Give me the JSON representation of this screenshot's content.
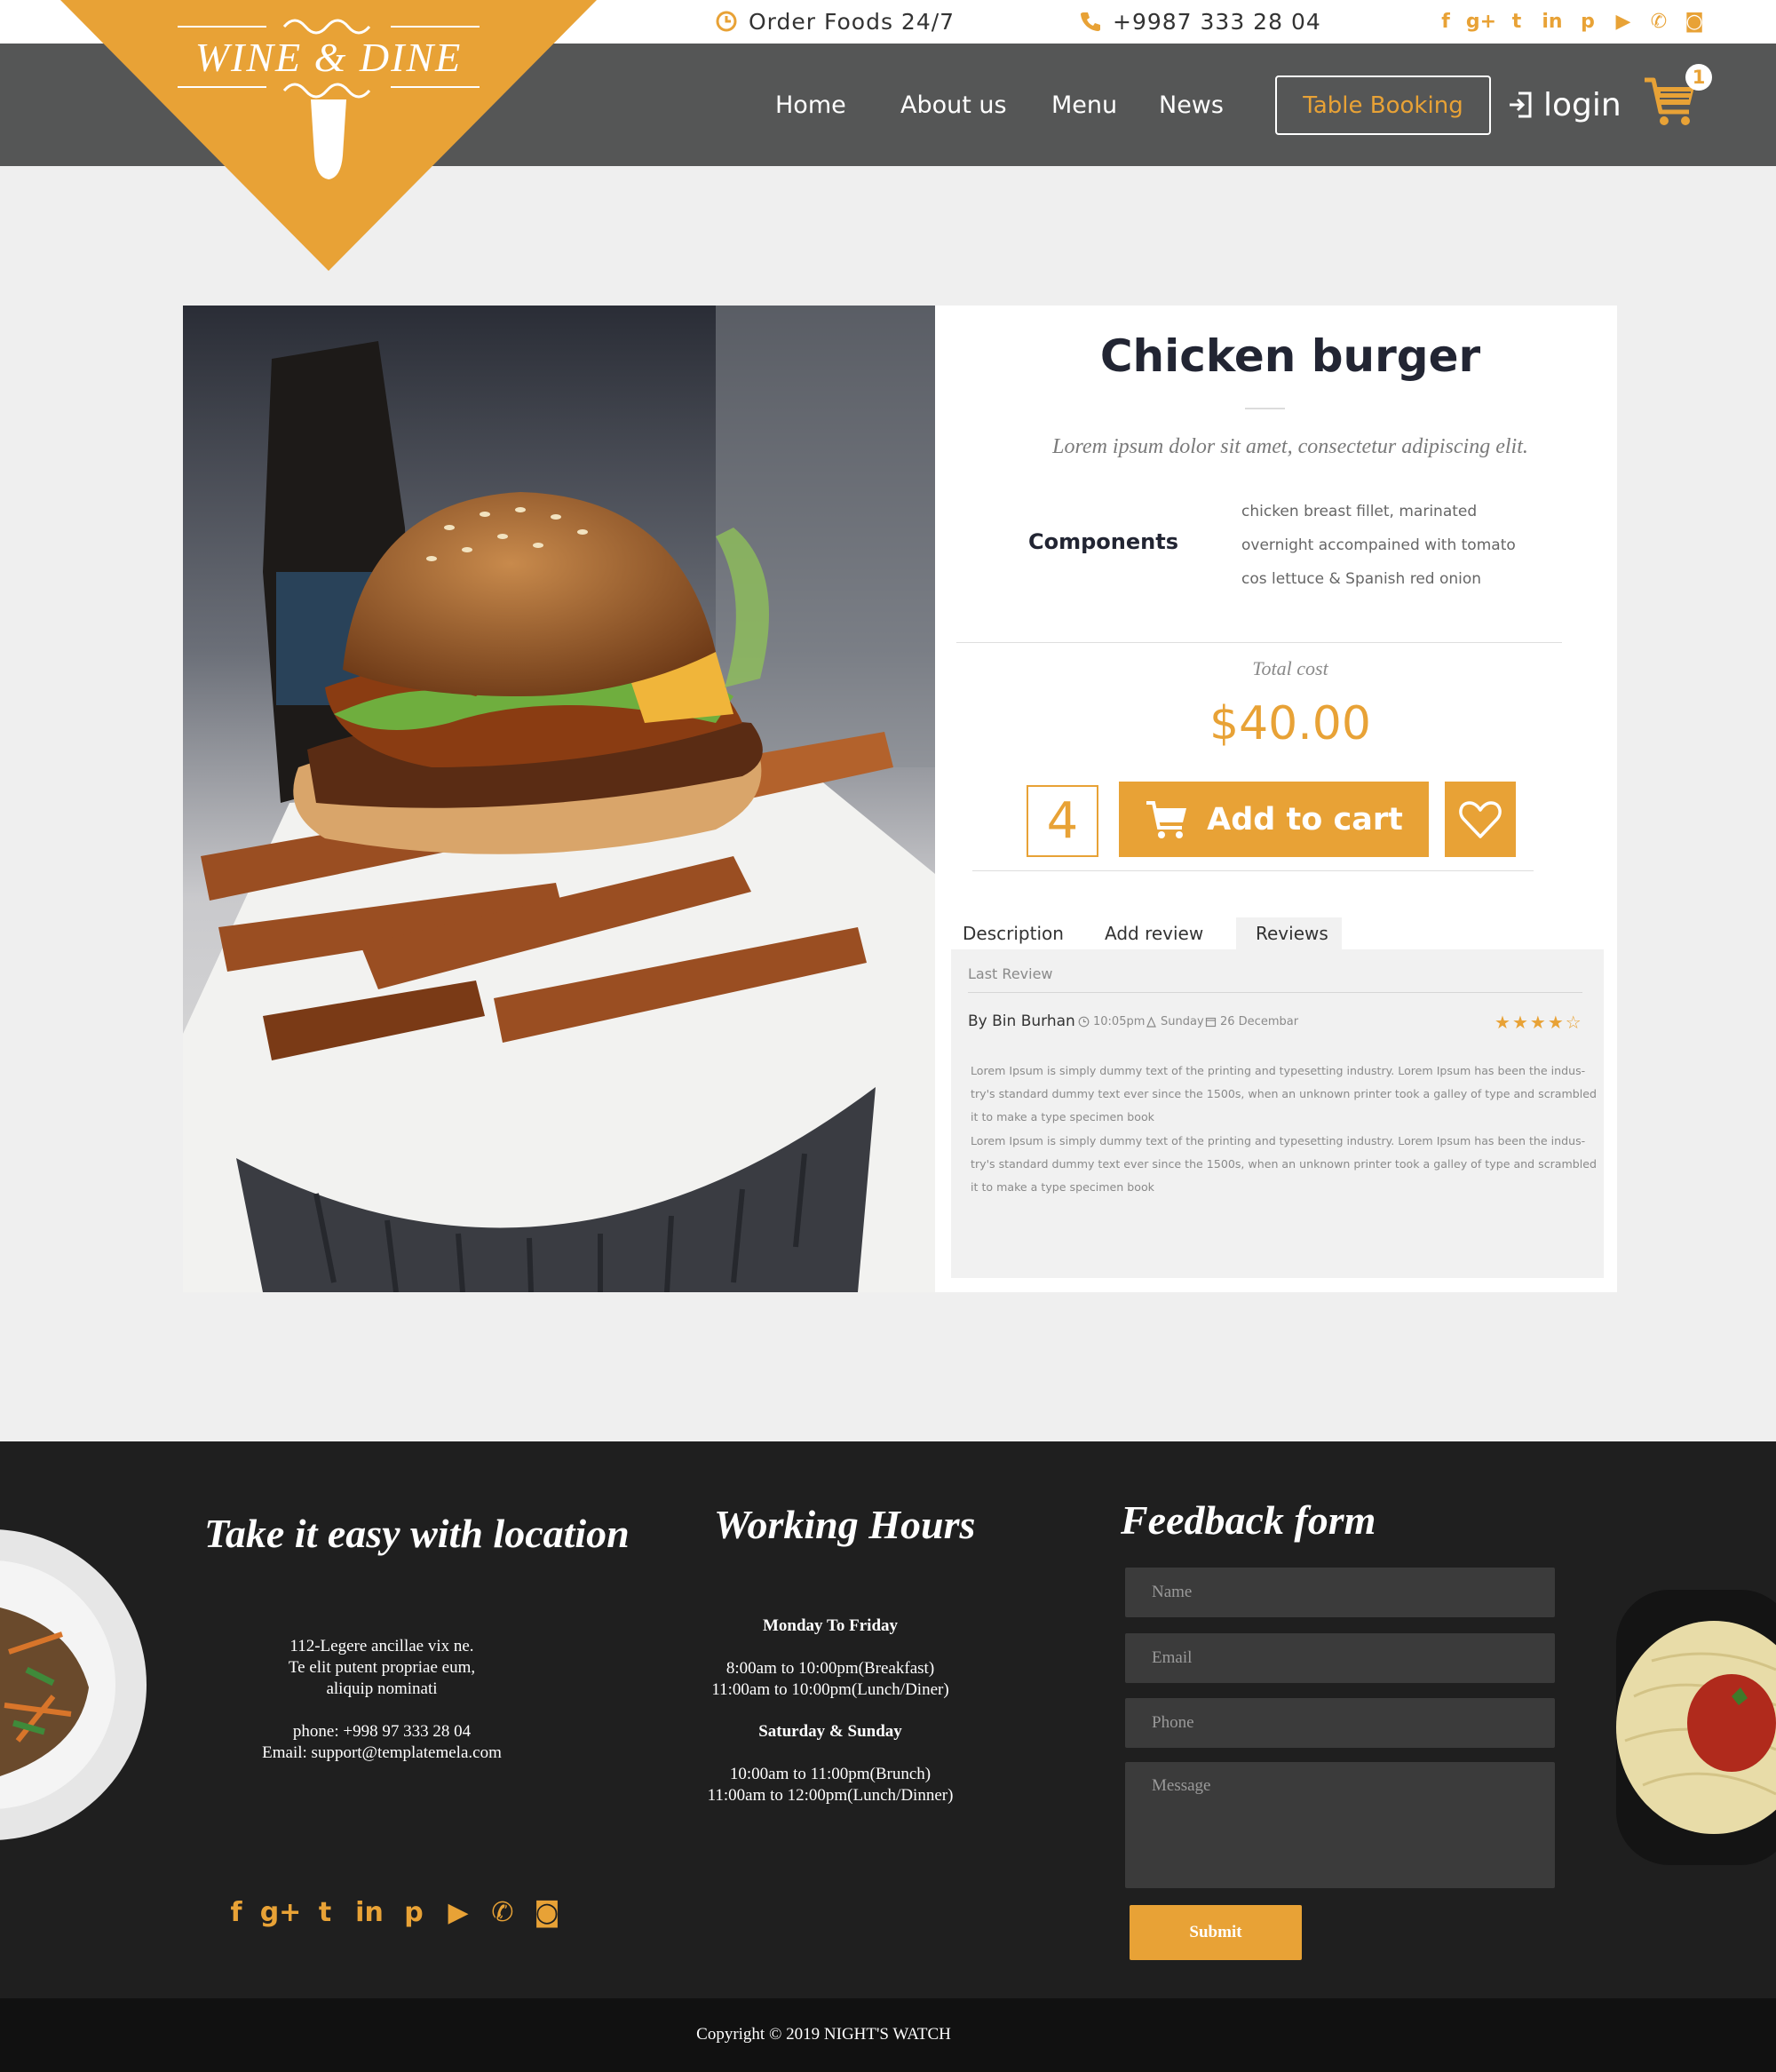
{
  "brand": {
    "name": "WINE & DINE",
    "accent_color": "#e8a236"
  },
  "topbar": {
    "order_text": "Order Foods 24/7",
    "order_icon": "clock-icon",
    "phone_text": "+9987 333 28 04",
    "phone_icon": "phone-icon",
    "social": [
      {
        "icon": "facebook-icon",
        "glyph": "f"
      },
      {
        "icon": "google-plus-icon",
        "glyph": "g+"
      },
      {
        "icon": "twitter-icon",
        "glyph": "t"
      },
      {
        "icon": "linkedin-icon",
        "glyph": "in"
      },
      {
        "icon": "pinterest-icon",
        "glyph": "p"
      },
      {
        "icon": "youtube-icon",
        "glyph": "▶"
      },
      {
        "icon": "whatsapp-icon",
        "glyph": "✆"
      },
      {
        "icon": "instagram-icon",
        "glyph": "◙"
      }
    ]
  },
  "nav": {
    "items": [
      "Home",
      "About us",
      "Menu",
      "News"
    ],
    "booking": "Table Booking",
    "login": "login",
    "cart_count": "1"
  },
  "product": {
    "title": "Chicken burger",
    "subtitle": "Lorem ipsum dolor sit amet, consectetur adipiscing elit.",
    "components_label": "Components",
    "components_lines": [
      "chicken breast fillet, marinated",
      "overnight accompained with tomato",
      "cos lettuce & Spanish red onion"
    ],
    "total_cost_label": "Total cost",
    "price": "$40.00",
    "quantity": "4",
    "add_to_cart": "Add to cart"
  },
  "tabs": {
    "items": [
      "Description",
      "Add review",
      "Reviews"
    ],
    "active": "Reviews"
  },
  "review": {
    "section_label": "Last Review",
    "author": "By Bin Burhan",
    "time": "10:05pm",
    "day": "Sunday",
    "date": "26 Decembar",
    "rating": 4,
    "rating_max": 5,
    "lines": [
      "Lorem Ipsum is simply dummy text of the printing and typesetting industry. Lorem Ipsum has been the indus-",
      "try's standard dummy text ever since the 1500s, when an unknown printer took a galley of type and scrambled",
      "it to make a type specimen book",
      "Lorem Ipsum is simply dummy text of the printing and typesetting industry. Lorem Ipsum has been the indus-",
      "try's standard dummy text ever since the 1500s, when an unknown printer took a galley of type and scrambled",
      "it to make a type specimen book"
    ]
  },
  "footer": {
    "location": {
      "heading": "Take it easy with location",
      "address": [
        "112-Legere ancillae vix ne.",
        "Te elit putent propriae eum,",
        "aliquip nominati"
      ],
      "phone": "phone: +998 97 333 28 04",
      "email": "Email: support@templatemela.com"
    },
    "hours": {
      "heading": "Working Hours",
      "weekday_label": "Monday To Friday",
      "weekday_lines": [
        "8:00am to 10:00pm(Breakfast)",
        "11:00am to 10:00pm(Lunch/Diner)"
      ],
      "weekend_label": "Saturday & Sunday",
      "weekend_lines": [
        "10:00am to 11:00pm(Brunch)",
        "11:00am to 12:00pm(Lunch/Dinner)"
      ]
    },
    "feedback": {
      "heading": "Feedback form",
      "name_placeholder": "Name",
      "email_placeholder": "Email",
      "phone_placeholder": "Phone",
      "message_placeholder": "Message",
      "submit": "Submit"
    },
    "copyright": "Copyright © 2019 NIGHT'S WATCH"
  }
}
